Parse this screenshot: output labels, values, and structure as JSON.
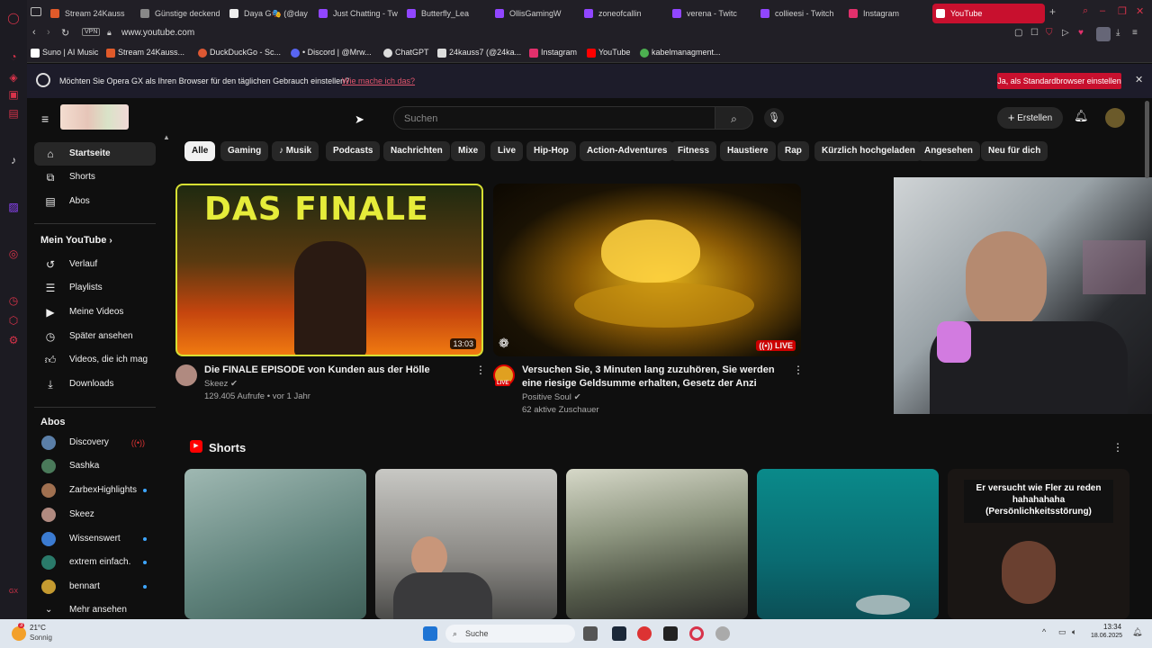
{
  "browser": {
    "tabs": [
      {
        "label": "Stream 24Kauss",
        "color": "#e05a2a"
      },
      {
        "label": "Günstige deckend",
        "color": "#888888"
      },
      {
        "label": "Daya G🎭 (@day",
        "color": "#ffffff"
      },
      {
        "label": "Just Chatting - Tw",
        "color": "#9146ff"
      },
      {
        "label": "Butterfly_Lea",
        "color": "#9146ff"
      },
      {
        "label": "OllisGamingW",
        "color": "#9146ff"
      },
      {
        "label": "zoneofcallin",
        "color": "#9146ff"
      },
      {
        "label": "verena - Twitc",
        "color": "#9146ff"
      },
      {
        "label": "collieesi - Twitch",
        "color": "#9146ff"
      },
      {
        "label": "Instagram",
        "color": "#e1306c"
      },
      {
        "label": "YouTube",
        "color": "#ff0000"
      }
    ],
    "vpn_label": "VPN",
    "url": "www.youtube.com",
    "bookmarks": [
      {
        "label": "Suno | AI Music",
        "color": "#ffffff"
      },
      {
        "label": "Stream 24Kauss...",
        "color": "#e05a2a"
      },
      {
        "label": "DuckDuckGo - Sc...",
        "color": "#de5833"
      },
      {
        "label": "• Discord | @Mrw...",
        "color": "#5865f2"
      },
      {
        "label": "ChatGPT",
        "color": "#ffffff"
      },
      {
        "label": "24kauss7 (@24ka...",
        "color": "#ffffff"
      },
      {
        "label": "Instagram",
        "color": "#e1306c"
      },
      {
        "label": "YouTube",
        "color": "#ff0000"
      },
      {
        "label": "kabelmanagment...",
        "color": "#4caf50"
      }
    ],
    "banner": {
      "message": "Möchten Sie Opera GX als Ihren Browser für den täglichen Gebrauch einstellen?",
      "link": "Wie mache ich das?",
      "button": "Ja, als Standardbrowser einstellen"
    }
  },
  "youtube": {
    "search_placeholder": "Suchen",
    "create_label": "Erstellen",
    "sidebar": {
      "main": [
        {
          "label": "Startseite",
          "icon": "home-icon"
        },
        {
          "label": "Shorts",
          "icon": "shorts-icon"
        },
        {
          "label": "Abos",
          "icon": "subscriptions-icon"
        }
      ],
      "you_heading": "Mein YouTube",
      "you": [
        {
          "label": "Verlauf",
          "icon": "history-icon"
        },
        {
          "label": "Playlists",
          "icon": "playlists-icon"
        },
        {
          "label": "Meine Videos",
          "icon": "my-videos-icon"
        },
        {
          "label": "Später ansehen",
          "icon": "watch-later-icon"
        },
        {
          "label": "Videos, die ich mag",
          "icon": "liked-icon"
        },
        {
          "label": "Downloads",
          "icon": "downloads-icon"
        }
      ],
      "subs_heading": "Abos",
      "subs": [
        {
          "label": "Discovery",
          "color": "#5b7fa8",
          "live": true
        },
        {
          "label": "Sashka",
          "color": "#4a7a5a",
          "live": false
        },
        {
          "label": "ZarbexHighlights",
          "color": "#a07050",
          "live": false
        },
        {
          "label": "Skeez",
          "color": "#b08a80",
          "live": false
        },
        {
          "label": "Wissenswert",
          "color": "#3b7bd1",
          "live": false
        },
        {
          "label": "extrem einfach.",
          "color": "#2a7a6a",
          "live": false
        },
        {
          "label": "bennart",
          "color": "#c49a30",
          "live": false
        }
      ],
      "more": "Mehr ansehen"
    },
    "chips": [
      "Alle",
      "Gaming",
      "Musik",
      "Podcasts",
      "Nachrichten",
      "Mixe",
      "Live",
      "Hip-Hop",
      "Action-Adventures",
      "Fitness",
      "Haustiere",
      "Rap",
      "Kürzlich hochgeladen",
      "Angesehen",
      "Neu für dich"
    ],
    "videos": [
      {
        "thumb_text": "DAS FINALE",
        "duration": "13:03",
        "title": "Die FINALE EPISODE von Kunden aus der Hölle",
        "channel": "Skeez",
        "meta": "129.405 Aufrufe • vor 1 Jahr"
      },
      {
        "live_badge": "LIVE",
        "avatar_badge": "LIVE",
        "title": "Versuchen Sie, 3 Minuten lang zuzuhören, Sie werden eine riesige Geldsumme erhalten, Gesetz der Anzi",
        "channel": "Positive Soul",
        "meta": "62 aktive Zuschauer"
      }
    ],
    "shorts_heading": "Shorts",
    "shorts_caption": "Er versucht wie Fler zu reden hahahahaha (Persönlichkeitsstörung)"
  },
  "taskbar": {
    "weather_temp": "21°C",
    "weather_desc": "Sonnig",
    "weather_badge": "3",
    "search": "Suche",
    "time": "13:34",
    "date": "18.06.2025"
  }
}
